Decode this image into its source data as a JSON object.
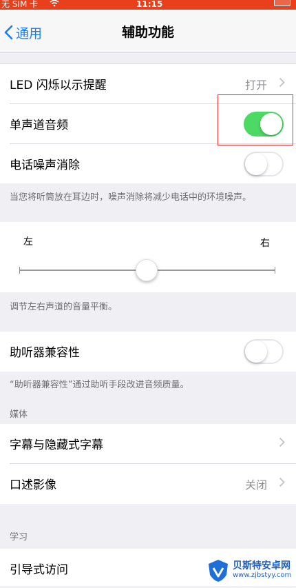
{
  "status_bar": {
    "carrier": "无 SIM 卡",
    "time": "11:15"
  },
  "nav": {
    "back_label": "通用",
    "title": "辅助功能"
  },
  "rows": {
    "led_flash": {
      "label": "LED 闪烁以示提醒",
      "value": "打开"
    },
    "mono_audio": {
      "label": "单声道音频",
      "on": true
    },
    "noise_cancel": {
      "label": "电话噪声消除",
      "on": false
    }
  },
  "noise_footnote": "当您将听筒放在耳边时，噪声消除将减少电话中的环境噪声。",
  "balance": {
    "left_label": "左",
    "right_label": "右",
    "value": 0.5
  },
  "balance_footnote": "调节左右声道的音量平衡。",
  "hearing_aid": {
    "label": "助听器兼容性",
    "on": false
  },
  "hearing_footnote": "“助听器兼容性”通过助听手段改进音频质量。",
  "media_section": {
    "header": "媒体",
    "items": [
      {
        "label": "字幕与隐藏式字幕",
        "value": ""
      },
      {
        "label": "口述影像",
        "value": "关闭"
      }
    ]
  },
  "learning_section": {
    "header": "学习",
    "items": [
      {
        "label": "引导式访问"
      }
    ]
  },
  "watermark": {
    "title": "贝斯特安卓网",
    "url": "www.zjbstyy.com"
  },
  "colors": {
    "accent": "#1a7cf5",
    "toggle_on": "#4cd964",
    "status_bar": "#e8401c",
    "highlight": "#e03030"
  }
}
